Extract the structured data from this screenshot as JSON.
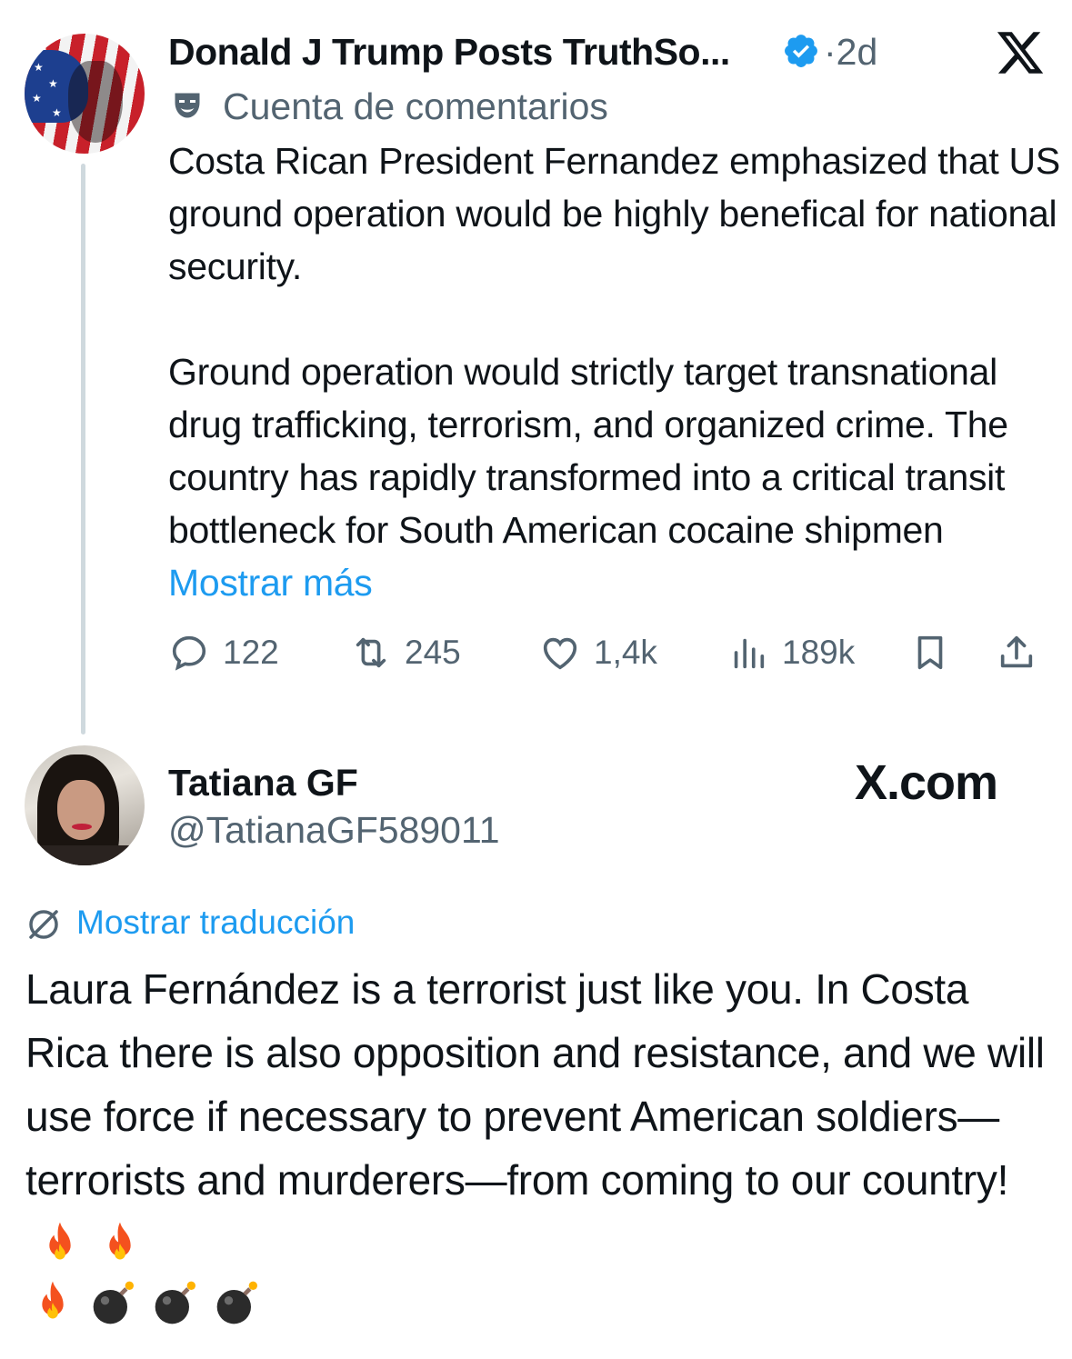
{
  "post": {
    "author_name": "Donald J Trump Posts TruthSo...",
    "separator": "·",
    "time": "2d",
    "label": "Cuenta de comentarios",
    "paragraph1": "Costa Rican President Fernandez emphasized that US ground operation would be highly benefical for national security.",
    "paragraph2": "Ground operation would strictly target transnational drug trafficking, terrorism, and organized crime. The country has rapidly transformed into a critical transit bottleneck for South American cocaine shipmen",
    "show_more": "Mostrar más",
    "actions": {
      "replies": "122",
      "reposts": "245",
      "likes": "1,4k",
      "views": "189k"
    }
  },
  "reply": {
    "author_name": "Tatiana GF",
    "handle": "@TatianaGF589011",
    "watermark": "X.com",
    "translate_label": "Mostrar traducción",
    "text": "Laura Fernández is a terrorist just like you. In Costa Rica there is also opposition and resistance, and we will use force if necessary to prevent American soldiers—terrorists and murderers—from coming to our country!",
    "emojis": [
      "fire-emoji",
      "fire-emoji",
      "fire-emoji",
      "bomb-emoji",
      "bomb-emoji",
      "bomb-emoji"
    ]
  },
  "colors": {
    "text": "#0f1419",
    "secondary": "#536471",
    "accent": "#1d9bf0",
    "thread_line": "#cfd9de"
  }
}
